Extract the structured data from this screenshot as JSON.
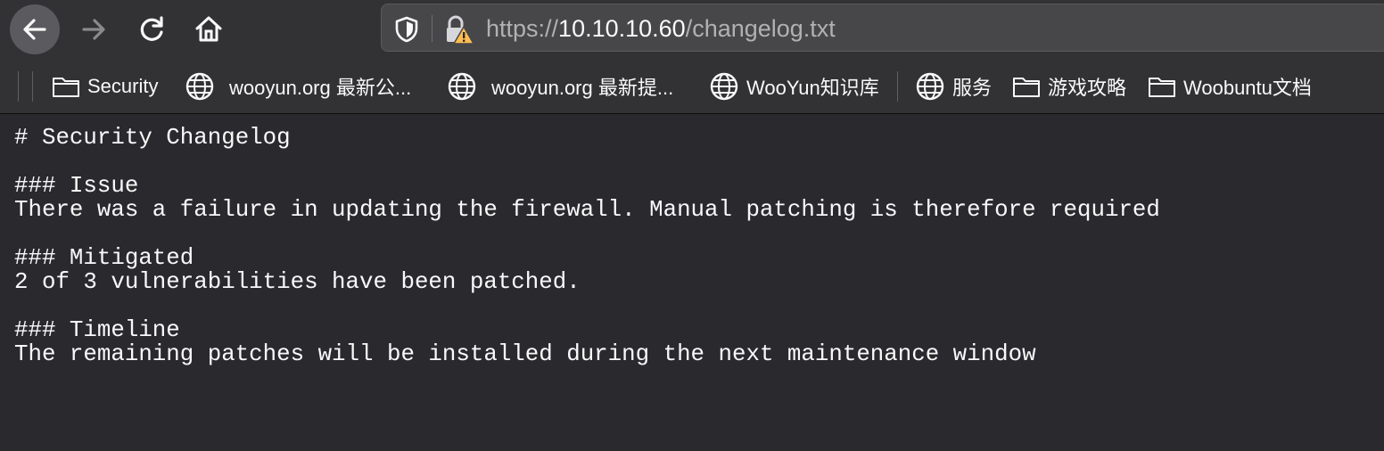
{
  "url": {
    "scheme": "https://",
    "host": "10.10.10.60",
    "path": "/changelog.txt"
  },
  "bookmarks": [
    {
      "label": "Security",
      "icon": "folder-icon"
    },
    {
      "label": "wooyun.org 最新公...",
      "icon": "globe-icon"
    },
    {
      "label": "wooyun.org 最新提...",
      "icon": "globe-icon"
    },
    {
      "label": "WooYun知识库",
      "icon": "globe-icon"
    },
    {
      "label": "服务",
      "icon": "globe-icon"
    },
    {
      "label": "游戏攻略",
      "icon": "folder-icon"
    },
    {
      "label": "Woobuntu文档",
      "icon": "folder-icon"
    }
  ],
  "document": {
    "lines": [
      "# Security Changelog",
      "",
      "### Issue",
      "There was a failure in updating the firewall. Manual patching is therefore required",
      "",
      "### Mitigated",
      "2 of 3 vulnerabilities have been patched.",
      "",
      "### Timeline",
      "The remaining patches will be installed during the next maintenance window"
    ]
  },
  "colors": {
    "page_background": "#2a2a2e",
    "toolbar": "#323234",
    "urlbar": "#474749",
    "text": "#f9f9fa",
    "warning": "#ffbd4f"
  }
}
